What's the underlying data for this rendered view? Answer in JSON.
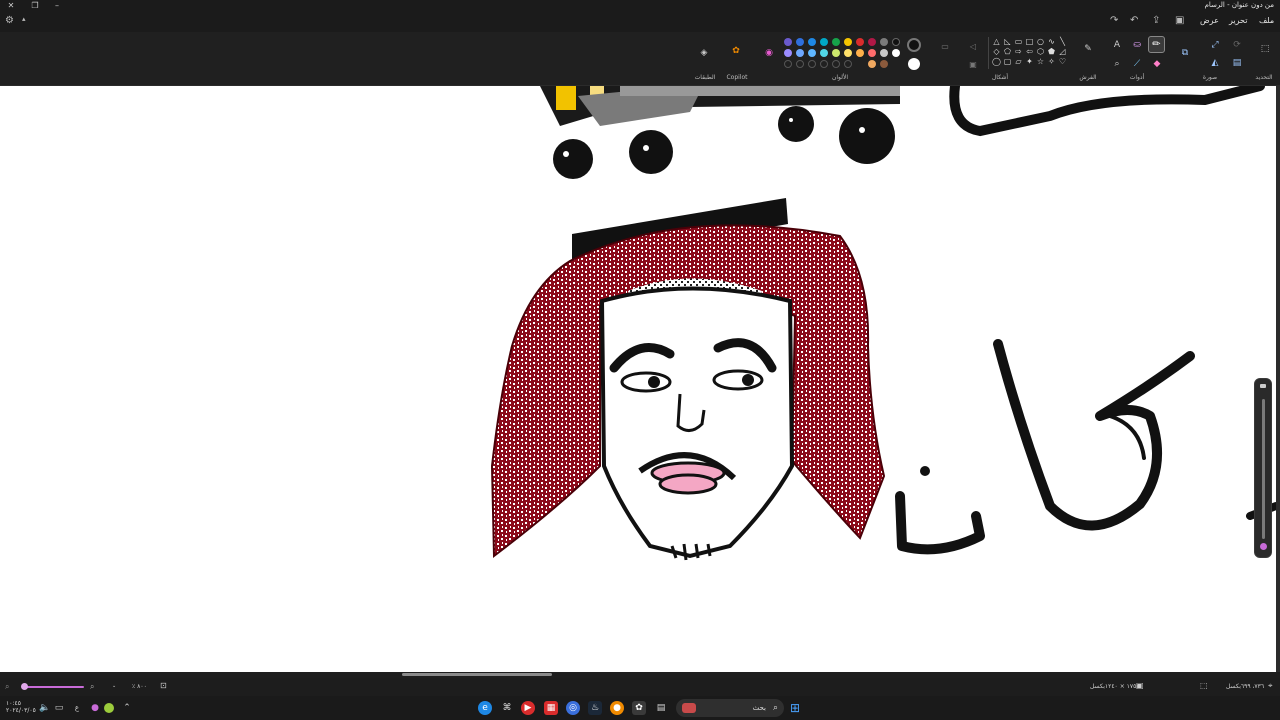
{
  "window": {
    "title": "من دون عنوان - الرسام"
  },
  "menu": {
    "file": "ملف",
    "edit": "تحرير",
    "view": "عرض"
  },
  "ribbon": {
    "groups": {
      "selection": "التحديد",
      "image": "صورة",
      "tools": "أدوات",
      "brushes": "الفرش",
      "shapes": "أشكال",
      "colors": "الألوان",
      "copilot": "Copilot",
      "layers": "الطبقات"
    },
    "colors": {
      "row1": [
        "#6a5acd",
        "#2f6fdc",
        "#1e88e5",
        "#00a8c6",
        "#16a34a",
        "#9ccc3c",
        "#f5c400",
        "#f08a00",
        "#d92c2c",
        "#b01846",
        "#7b7b7b",
        "#111111"
      ],
      "row2": [
        "#9b8cff",
        "#6ea8ff",
        "#5fb6ff",
        "#52d6e6",
        "#5ed27a",
        "#cde86c",
        "#ffe16a",
        "#ffb04a",
        "#ff6d6d",
        "#ff6fa5",
        "#c8c8c8",
        "#ffffff"
      ],
      "primary": "#111111",
      "secondary": "#ffffff"
    }
  },
  "drawing": {
    "keffiyeh_color": "#8b0a1a",
    "lips_color": "#f4a7c4",
    "cart_accent": "#f2c200"
  },
  "status": {
    "position": "٧٣٦، ٦٩٩بكسل",
    "size": "١٧٥٤ × ١٢٤٠بكسل",
    "zoom": "٨٠٠ ٪"
  },
  "taskbar": {
    "search_placeholder": "بحث",
    "time": "١٠:٤٥",
    "date": "٢٠٢٤/٠٣/٠٥"
  }
}
